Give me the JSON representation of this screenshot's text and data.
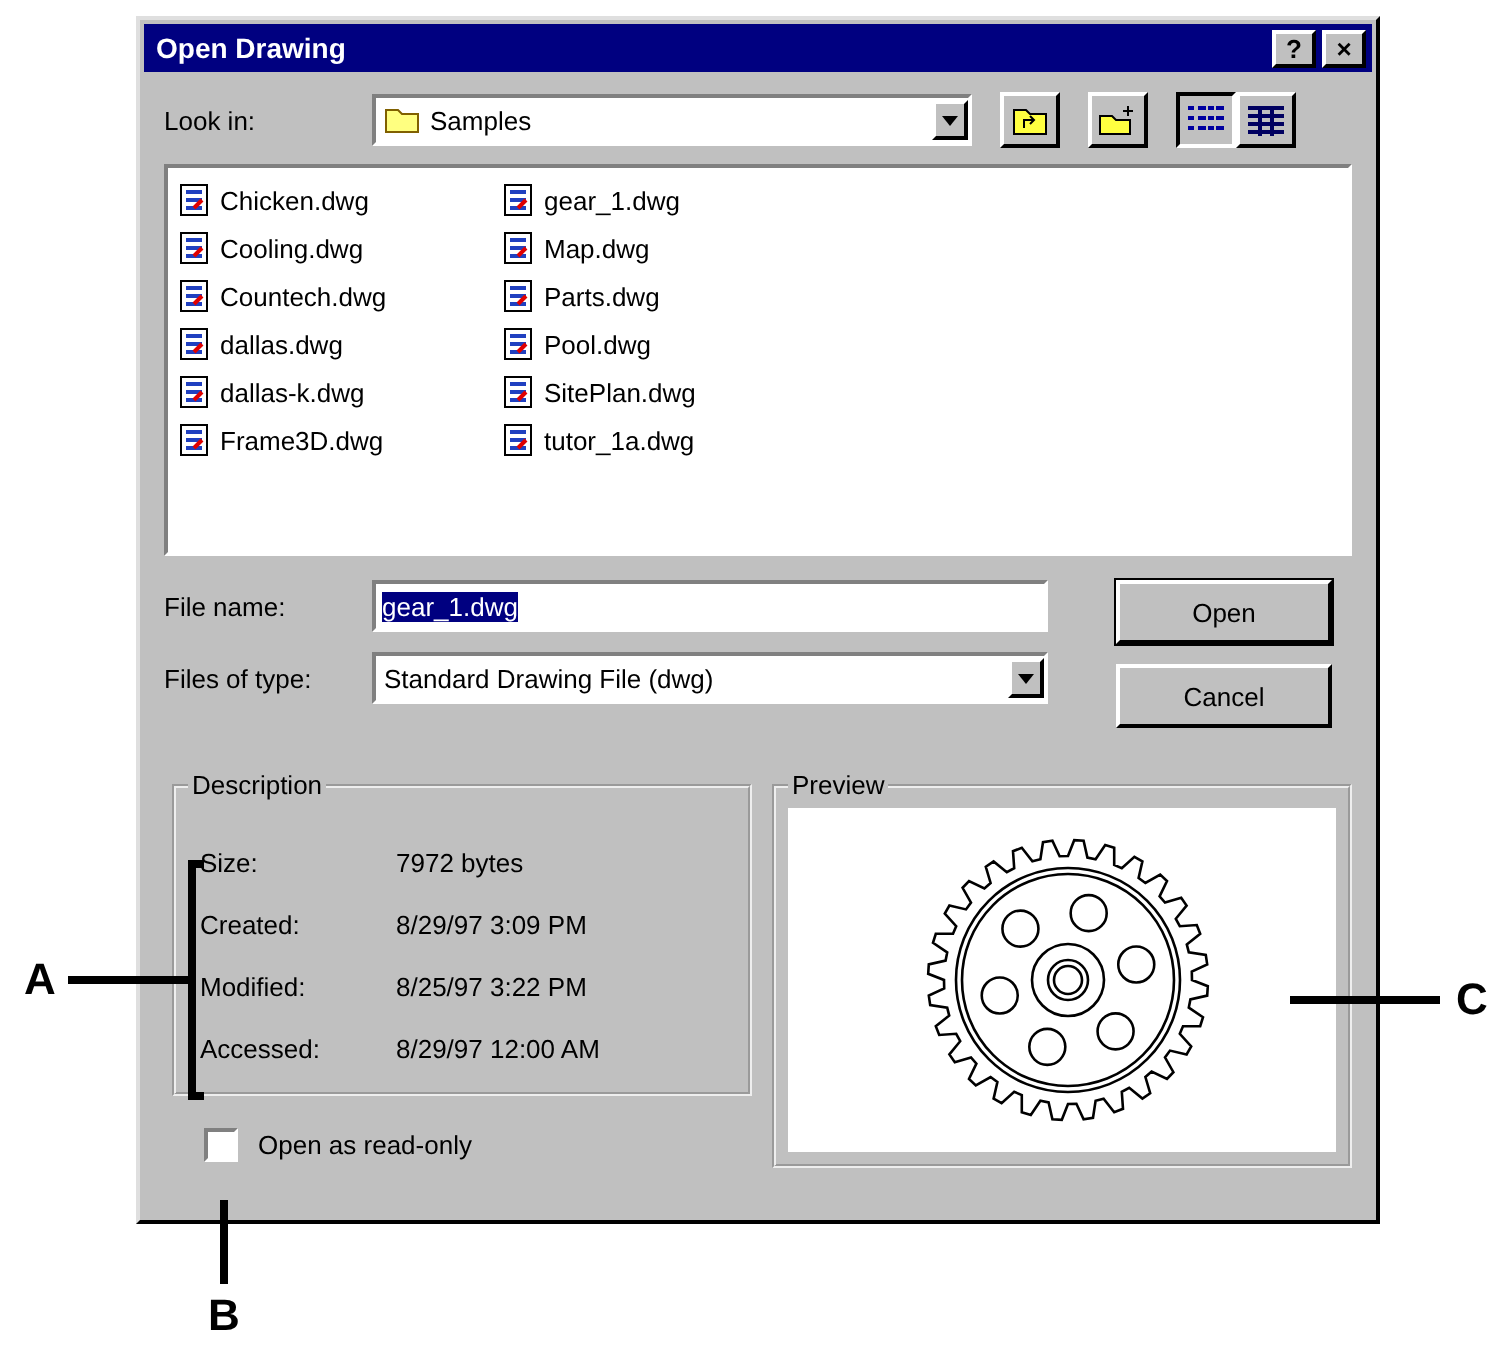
{
  "window": {
    "title": "Open Drawing",
    "title_buttons": [
      "?",
      "×"
    ]
  },
  "look_in": {
    "label": "Look in:",
    "value": "Samples"
  },
  "view_buttons": [
    {
      "kind": "list",
      "selected": true
    },
    {
      "kind": "details",
      "selected": false
    }
  ],
  "files": [
    [
      "Chicken.dwg",
      "Cooling.dwg",
      "Countech.dwg",
      "dallas.dwg",
      "dallas-k.dwg",
      "Frame3D.dwg"
    ],
    [
      "gear_1.dwg",
      "Map.dwg",
      "Parts.dwg",
      "Pool.dwg",
      "SitePlan.dwg",
      "tutor_1a.dwg"
    ]
  ],
  "file_name": {
    "label": "File name:",
    "value": "gear_1.dwg"
  },
  "file_type": {
    "label": "Files of type:",
    "value": "Standard Drawing File (dwg)"
  },
  "buttons": [
    {
      "label": "Open",
      "default": true
    },
    {
      "label": "Cancel",
      "default": false
    }
  ],
  "description": {
    "title": "Description",
    "rows": [
      {
        "label": "Size:",
        "value": "7972 bytes"
      },
      {
        "label": "Created:",
        "value": "8/29/97 3:09 PM"
      },
      {
        "label": "Modified:",
        "value": "8/25/97 3:22 PM"
      },
      {
        "label": "Accessed:",
        "value": "8/29/97 12:00 AM"
      }
    ]
  },
  "preview": {
    "title": "Preview"
  },
  "read_only": {
    "label": "Open as read-only",
    "checked": false
  },
  "callouts": [
    "A",
    "B",
    "C"
  ]
}
